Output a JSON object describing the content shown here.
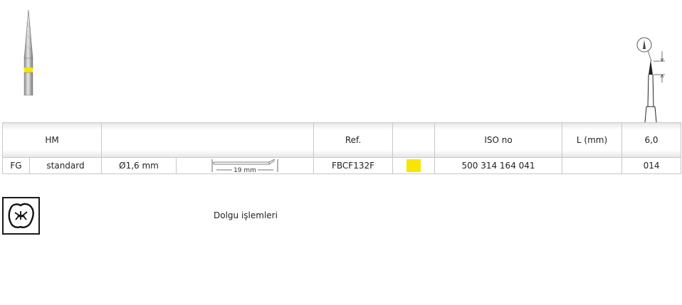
{
  "header": {
    "material": "HM",
    "diameter_col": "",
    "ref_label": "Ref.",
    "color_col": "",
    "iso_label": "ISO no",
    "length_label": "L (mm)",
    "length_value": "6,0"
  },
  "product": {
    "type": "FG",
    "shank": "standard",
    "diameter": "Ø1,6 mm",
    "shank_length": "19 mm",
    "ref": "FBCF132F",
    "color_code": "#f7e600",
    "iso": "500 314 164 041",
    "length_blank": "",
    "size": "014"
  },
  "usage": {
    "icon": "filling-tooth-icon",
    "label": "Dolgu işlemleri"
  }
}
